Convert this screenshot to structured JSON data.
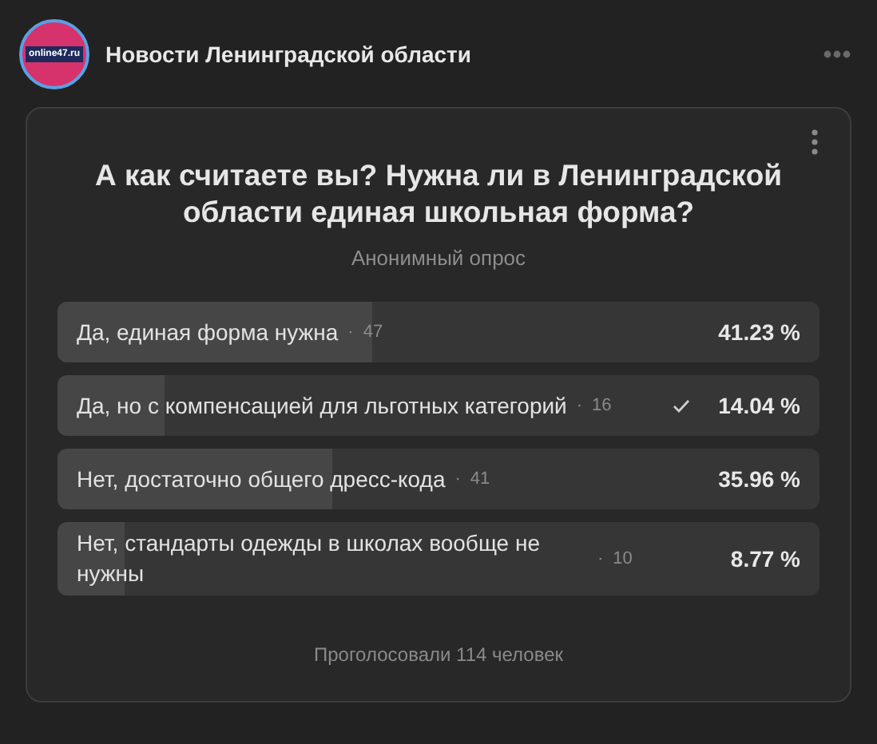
{
  "header": {
    "logo_text": "online47.ru",
    "title": "Новости Ленинградской области"
  },
  "poll": {
    "question": "А как считаете вы? Нужна ли в Ленинградской области единая школьная форма?",
    "subtitle": "Анонимный опрос",
    "options": [
      {
        "label": "Да, единая форма нужна",
        "separator": "·",
        "count": "47",
        "percent": "41.23 %",
        "level": 0.4123,
        "selected": false
      },
      {
        "label": "Да, но с компенсацией для льготных категорий",
        "separator": "·",
        "count": "16",
        "percent": "14.04 %",
        "level": 0.1404,
        "selected": true
      },
      {
        "label": "Нет, достаточно общего дресс-кода",
        "separator": "·",
        "count": "41",
        "percent": "35.96 %",
        "level": 0.3596,
        "selected": false
      },
      {
        "label": "Нет, стандарты одежды в школах вообще не нужны",
        "separator": "·",
        "count": "10",
        "percent": "8.77 %",
        "level": 0.0877,
        "selected": false
      }
    ],
    "footer": "Проголосовали 114 человек"
  }
}
